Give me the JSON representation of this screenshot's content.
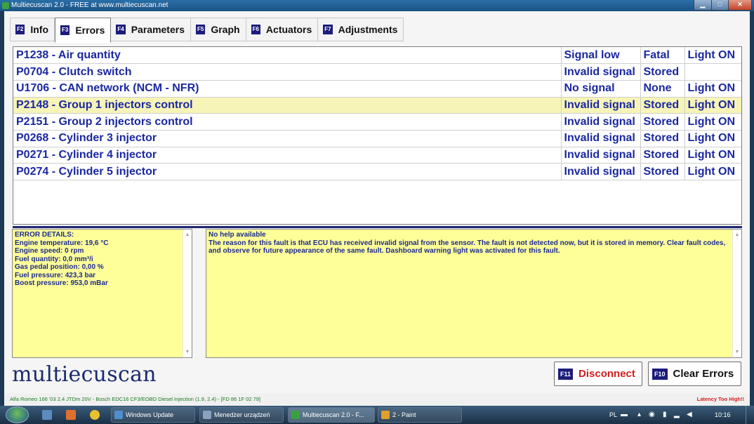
{
  "window": {
    "title": "Multiecuscan 2.0 - FREE at www.multiecuscan.net"
  },
  "tabs": [
    {
      "key": "F2",
      "label": "Info"
    },
    {
      "key": "F3",
      "label": "Errors",
      "active": true
    },
    {
      "key": "F4",
      "label": "Parameters"
    },
    {
      "key": "F5",
      "label": "Graph"
    },
    {
      "key": "F6",
      "label": "Actuators"
    },
    {
      "key": "F7",
      "label": "Adjustments"
    }
  ],
  "faults": [
    {
      "code": "P1238 - Air quantity",
      "status": "Signal low",
      "type": "Fatal",
      "light": "Light ON"
    },
    {
      "code": "P0704 - Clutch switch",
      "status": "Invalid signal",
      "type": "Stored",
      "light": ""
    },
    {
      "code": "U1706 - CAN network (NCM - NFR)",
      "status": "No signal",
      "type": "None",
      "light": "Light ON"
    },
    {
      "code": "P2148 - Group 1 injectors control",
      "status": "Invalid signal",
      "type": "Stored",
      "light": "Light ON",
      "selected": true
    },
    {
      "code": "P2151 - Group 2 injectors control",
      "status": "Invalid signal",
      "type": "Stored",
      "light": "Light ON"
    },
    {
      "code": "P0268 - Cylinder 3 injector",
      "status": "Invalid signal",
      "type": "Stored",
      "light": "Light ON"
    },
    {
      "code": "P0271 - Cylinder 4 injector",
      "status": "Invalid signal",
      "type": "Stored",
      "light": "Light ON"
    },
    {
      "code": "P0274 - Cylinder 5 injector",
      "status": "Invalid signal",
      "type": "Stored",
      "light": "Light ON"
    }
  ],
  "details": {
    "heading": "ERROR DETAILS:",
    "lines": [
      "Engine temperature: 19,6 °C",
      "Engine speed: 0 rpm",
      "Fuel quantity: 0,0 mm³/i",
      "Gas pedal position: 0,00 %",
      "Fuel pressure: 423,3 bar",
      "Boost pressure: 953,0 mBar"
    ]
  },
  "help": {
    "heading": "No help available",
    "text": "The reason for this fault is that ECU has received invalid signal from the sensor. The fault is not detected now, but it is stored in memory. Clear fault codes, and observe for future appearance of the same fault. Dashboard warning light was activated for this fault."
  },
  "logo": "multiecuscan",
  "buttons": {
    "disconnect": {
      "key": "F11",
      "label": "Disconnect"
    },
    "clear": {
      "key": "F10",
      "label": "Clear Errors"
    }
  },
  "status": {
    "vehicle": "Alfa Romeo 166 '03 2.4 JTDm 20V - Bosch EDC16 CF3/EOBD Diesel Injection (1.9, 2.4) - [FD 86 1F 02 79]",
    "latency": "Latency Too High!!"
  },
  "taskbar": {
    "items": [
      {
        "label": "Windows Update",
        "color": "#4f8fd0"
      },
      {
        "label": "Menedżer urządzeń",
        "color": "#8aa2c0"
      },
      {
        "label": "Multiecuscan 2.0 - F...",
        "color": "#3ba042",
        "active": true
      },
      {
        "label": "2 - Paint",
        "color": "#e0a030"
      }
    ],
    "lang": "PL",
    "clock": "10:16"
  },
  "colors": {
    "fault_text": "#1a28a0",
    "selected_row": "#f7f4b7",
    "panel_bg": "#ffff99",
    "disconnect": "#d21f1f",
    "latency": "#d61b1b"
  }
}
